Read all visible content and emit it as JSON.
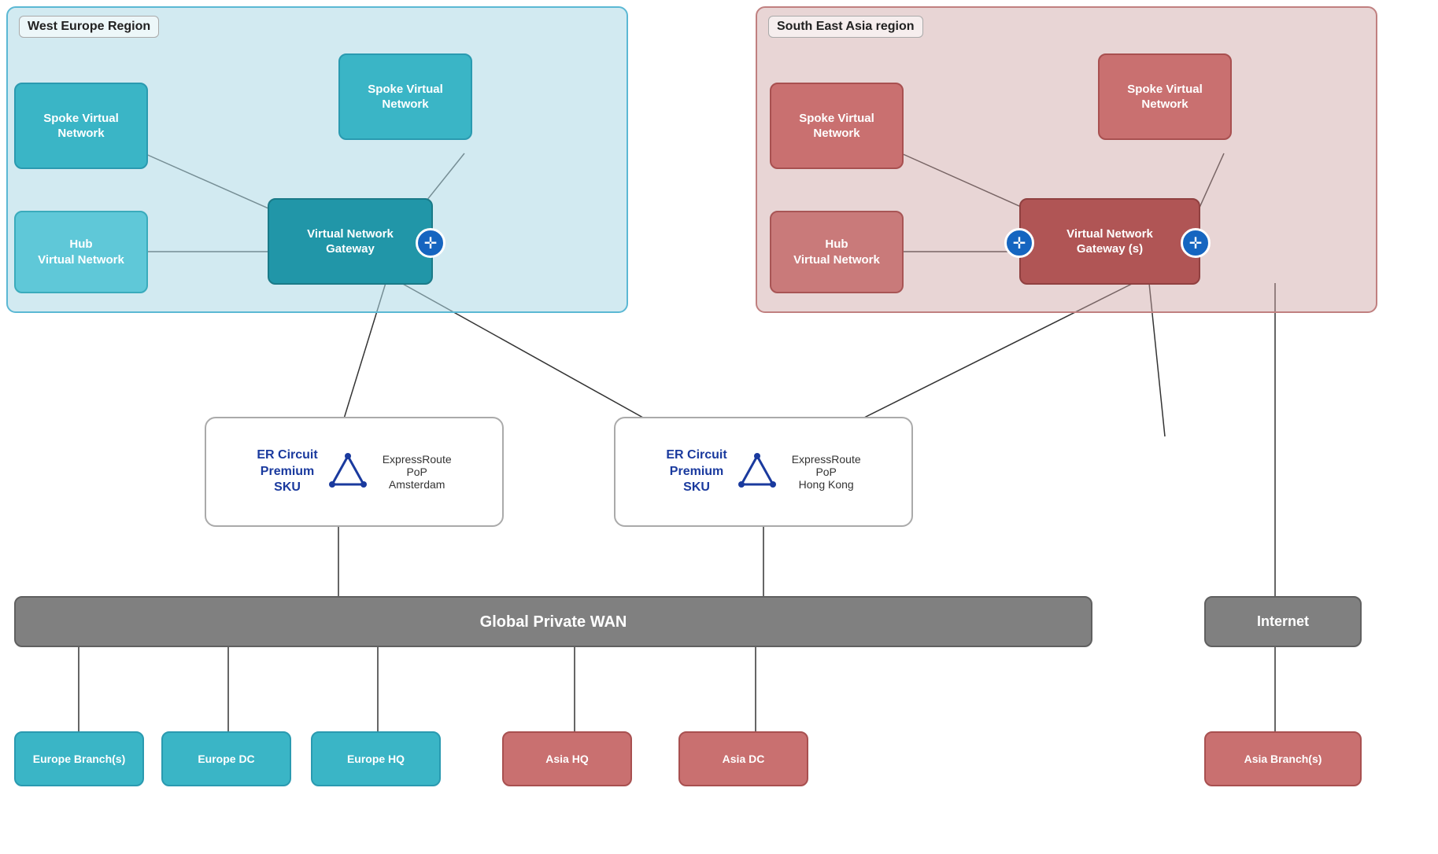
{
  "regions": {
    "west": {
      "label": "West Europe Region",
      "nodes": {
        "spoke1": "Spoke Virtual\nNetwork",
        "spoke2": "Spoke Virtual\nNetwork",
        "hub": "Hub\nVirtual Network",
        "gateway": "Virtual Network\nGateway"
      }
    },
    "sea": {
      "label": "South East Asia region",
      "nodes": {
        "spoke1": "Spoke Virtual\nNetwork",
        "spoke2": "Spoke Virtual\nNetwork",
        "hub": "Hub\nVirtual Network",
        "gateway": "Virtual Network\nGateway (s)"
      }
    }
  },
  "er_boxes": {
    "left": {
      "circuit": "ER Circuit\nPremium\nSKU",
      "pop": "ExpressRoute\nPoP\nAmsterdam"
    },
    "right": {
      "circuit": "ER Circuit\nPremium\nSKU",
      "pop": "ExpressRoute\nPoP\nHong Kong"
    }
  },
  "bottom": {
    "wan": "Global Private WAN",
    "internet": "Internet",
    "nodes": [
      "Europe Branch(s)",
      "Europe DC",
      "Europe HQ",
      "Asia HQ",
      "Asia DC",
      "Asia Branch(s)"
    ]
  }
}
